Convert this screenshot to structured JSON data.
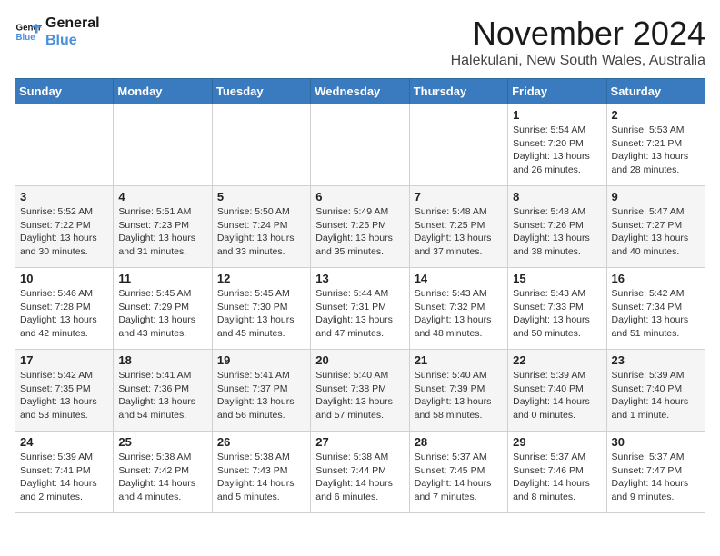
{
  "logo": {
    "line1": "General",
    "line2": "Blue"
  },
  "title": "November 2024",
  "location": "Halekulani, New South Wales, Australia",
  "weekdays": [
    "Sunday",
    "Monday",
    "Tuesday",
    "Wednesday",
    "Thursday",
    "Friday",
    "Saturday"
  ],
  "weeks": [
    [
      {
        "day": "",
        "info": ""
      },
      {
        "day": "",
        "info": ""
      },
      {
        "day": "",
        "info": ""
      },
      {
        "day": "",
        "info": ""
      },
      {
        "day": "",
        "info": ""
      },
      {
        "day": "1",
        "info": "Sunrise: 5:54 AM\nSunset: 7:20 PM\nDaylight: 13 hours and 26 minutes."
      },
      {
        "day": "2",
        "info": "Sunrise: 5:53 AM\nSunset: 7:21 PM\nDaylight: 13 hours and 28 minutes."
      }
    ],
    [
      {
        "day": "3",
        "info": "Sunrise: 5:52 AM\nSunset: 7:22 PM\nDaylight: 13 hours and 30 minutes."
      },
      {
        "day": "4",
        "info": "Sunrise: 5:51 AM\nSunset: 7:23 PM\nDaylight: 13 hours and 31 minutes."
      },
      {
        "day": "5",
        "info": "Sunrise: 5:50 AM\nSunset: 7:24 PM\nDaylight: 13 hours and 33 minutes."
      },
      {
        "day": "6",
        "info": "Sunrise: 5:49 AM\nSunset: 7:25 PM\nDaylight: 13 hours and 35 minutes."
      },
      {
        "day": "7",
        "info": "Sunrise: 5:48 AM\nSunset: 7:25 PM\nDaylight: 13 hours and 37 minutes."
      },
      {
        "day": "8",
        "info": "Sunrise: 5:48 AM\nSunset: 7:26 PM\nDaylight: 13 hours and 38 minutes."
      },
      {
        "day": "9",
        "info": "Sunrise: 5:47 AM\nSunset: 7:27 PM\nDaylight: 13 hours and 40 minutes."
      }
    ],
    [
      {
        "day": "10",
        "info": "Sunrise: 5:46 AM\nSunset: 7:28 PM\nDaylight: 13 hours and 42 minutes."
      },
      {
        "day": "11",
        "info": "Sunrise: 5:45 AM\nSunset: 7:29 PM\nDaylight: 13 hours and 43 minutes."
      },
      {
        "day": "12",
        "info": "Sunrise: 5:45 AM\nSunset: 7:30 PM\nDaylight: 13 hours and 45 minutes."
      },
      {
        "day": "13",
        "info": "Sunrise: 5:44 AM\nSunset: 7:31 PM\nDaylight: 13 hours and 47 minutes."
      },
      {
        "day": "14",
        "info": "Sunrise: 5:43 AM\nSunset: 7:32 PM\nDaylight: 13 hours and 48 minutes."
      },
      {
        "day": "15",
        "info": "Sunrise: 5:43 AM\nSunset: 7:33 PM\nDaylight: 13 hours and 50 minutes."
      },
      {
        "day": "16",
        "info": "Sunrise: 5:42 AM\nSunset: 7:34 PM\nDaylight: 13 hours and 51 minutes."
      }
    ],
    [
      {
        "day": "17",
        "info": "Sunrise: 5:42 AM\nSunset: 7:35 PM\nDaylight: 13 hours and 53 minutes."
      },
      {
        "day": "18",
        "info": "Sunrise: 5:41 AM\nSunset: 7:36 PM\nDaylight: 13 hours and 54 minutes."
      },
      {
        "day": "19",
        "info": "Sunrise: 5:41 AM\nSunset: 7:37 PM\nDaylight: 13 hours and 56 minutes."
      },
      {
        "day": "20",
        "info": "Sunrise: 5:40 AM\nSunset: 7:38 PM\nDaylight: 13 hours and 57 minutes."
      },
      {
        "day": "21",
        "info": "Sunrise: 5:40 AM\nSunset: 7:39 PM\nDaylight: 13 hours and 58 minutes."
      },
      {
        "day": "22",
        "info": "Sunrise: 5:39 AM\nSunset: 7:40 PM\nDaylight: 14 hours and 0 minutes."
      },
      {
        "day": "23",
        "info": "Sunrise: 5:39 AM\nSunset: 7:40 PM\nDaylight: 14 hours and 1 minute."
      }
    ],
    [
      {
        "day": "24",
        "info": "Sunrise: 5:39 AM\nSunset: 7:41 PM\nDaylight: 14 hours and 2 minutes."
      },
      {
        "day": "25",
        "info": "Sunrise: 5:38 AM\nSunset: 7:42 PM\nDaylight: 14 hours and 4 minutes."
      },
      {
        "day": "26",
        "info": "Sunrise: 5:38 AM\nSunset: 7:43 PM\nDaylight: 14 hours and 5 minutes."
      },
      {
        "day": "27",
        "info": "Sunrise: 5:38 AM\nSunset: 7:44 PM\nDaylight: 14 hours and 6 minutes."
      },
      {
        "day": "28",
        "info": "Sunrise: 5:37 AM\nSunset: 7:45 PM\nDaylight: 14 hours and 7 minutes."
      },
      {
        "day": "29",
        "info": "Sunrise: 5:37 AM\nSunset: 7:46 PM\nDaylight: 14 hours and 8 minutes."
      },
      {
        "day": "30",
        "info": "Sunrise: 5:37 AM\nSunset: 7:47 PM\nDaylight: 14 hours and 9 minutes."
      }
    ]
  ]
}
